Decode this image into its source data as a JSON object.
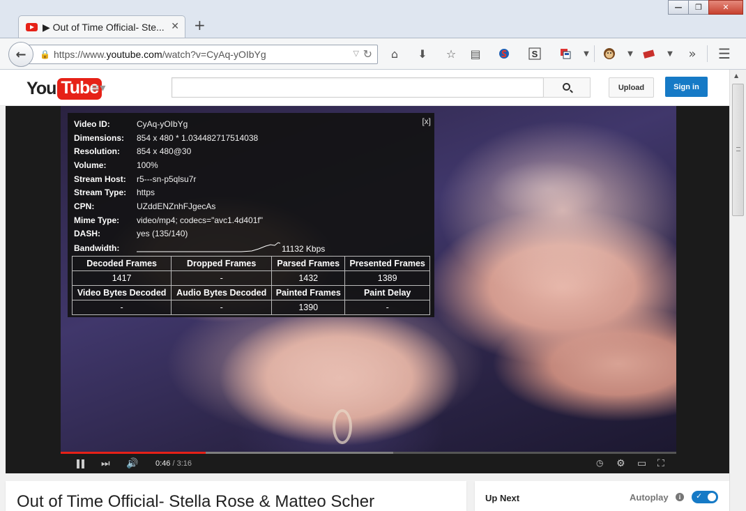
{
  "browser": {
    "tab_title": "▶ Out of Time Official- Ste...",
    "tab_close": "✕",
    "new_tab": "+",
    "url_prefix": "https://www.",
    "url_domain": "youtube.com",
    "url_path": "/watch?v=CyAq-yOIbYg",
    "window_controls": [
      "—",
      "❐",
      "✕"
    ],
    "toolbar_icons": [
      "home-icon",
      "download-icon",
      "bookmark-star-icon",
      "reading-list-icon",
      "stylish-icon",
      "s-extension-icon",
      "flag-extension-icon",
      "monkey-icon",
      "addon-icon",
      "overflow-icon",
      "menu-icon"
    ]
  },
  "youtube": {
    "logo_you": "You",
    "logo_tube": "Tube",
    "search_placeholder": "",
    "upload_label": "Upload",
    "signin_label": "Sign in",
    "brand_color": "#e62117",
    "signin_color": "#167ac6"
  },
  "stats": {
    "close_label": "[x]",
    "rows": [
      {
        "key": "Video ID:",
        "val": "CyAq-yOIbYg"
      },
      {
        "key": "Dimensions:",
        "val": "854 x 480 * 1.034482717514038"
      },
      {
        "key": "Resolution:",
        "val": "854 x 480@30"
      },
      {
        "key": "Volume:",
        "val": "100%"
      },
      {
        "key": "Stream Host:",
        "val": "r5---sn-p5qlsu7r"
      },
      {
        "key": "Stream Type:",
        "val": "https"
      },
      {
        "key": "CPN:",
        "val": "UZddENZnhFJgecAs"
      },
      {
        "key": "Mime Type:",
        "val": "video/mp4; codecs=\"avc1.4d401f\""
      },
      {
        "key": "DASH:",
        "val": "yes (135/140)"
      }
    ],
    "bandwidth_label": "Bandwidth:",
    "bandwidth_value": "11132 Kbps",
    "table": {
      "header1": [
        "Decoded Frames",
        "Dropped Frames",
        "Parsed Frames",
        "Presented Frames"
      ],
      "values1": [
        "1417",
        "-",
        "1432",
        "1389"
      ],
      "header2": [
        "Video Bytes Decoded",
        "Audio Bytes Decoded",
        "Painted Frames",
        "Paint Delay"
      ],
      "values2": [
        "-",
        "-",
        "1390",
        "-"
      ]
    }
  },
  "player": {
    "current_time": "0:46",
    "separator": " / ",
    "duration": "3:16",
    "progress_fraction": 0.235,
    "buffered_fraction": 0.54
  },
  "video": {
    "title": "Out of Time Official- Stella Rose & Matteo Scher"
  },
  "sidebar": {
    "up_next": "Up Next",
    "autoplay": "Autoplay",
    "info_icon": "i",
    "autoplay_on": true
  }
}
